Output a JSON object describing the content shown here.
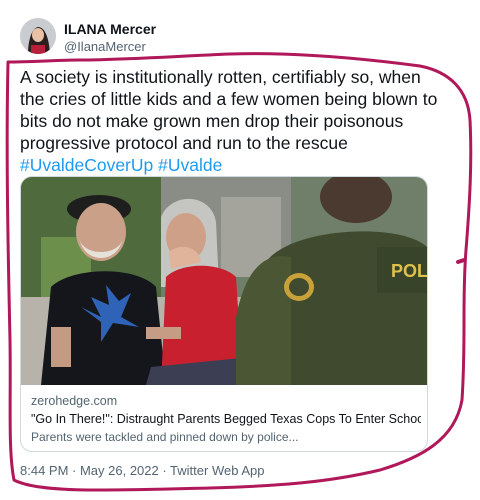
{
  "author": {
    "display_name": "ILANA Mercer",
    "handle": "@IlanaMercer",
    "avatar_icon": "profile-photo"
  },
  "tweet": {
    "lines": [
      "A society is institutionally rotten, certifiably so, when",
      "the cries of little kids and a few women being blown to",
      "bits do not make grown men drop their poisonous",
      "progressive protocol and run to the rescue"
    ],
    "hashtags": [
      "#UvaldeCoverUp",
      "#Uvalde"
    ]
  },
  "card": {
    "image_text": {
      "police_patch": "POLI"
    },
    "domain": "zerohedge.com",
    "title": "\"Go In There!\": Distraught Parents Begged Texas Cops To Enter School As Gun...",
    "description": "Parents were tackled and pinned down by police..."
  },
  "meta": {
    "timestamp": "8:44 PM · May 26, 2022 · Twitter Web App"
  },
  "colors": {
    "link": "#1d9bf0",
    "secondary_text": "#536471",
    "ink_annotation": "#b0185a"
  }
}
